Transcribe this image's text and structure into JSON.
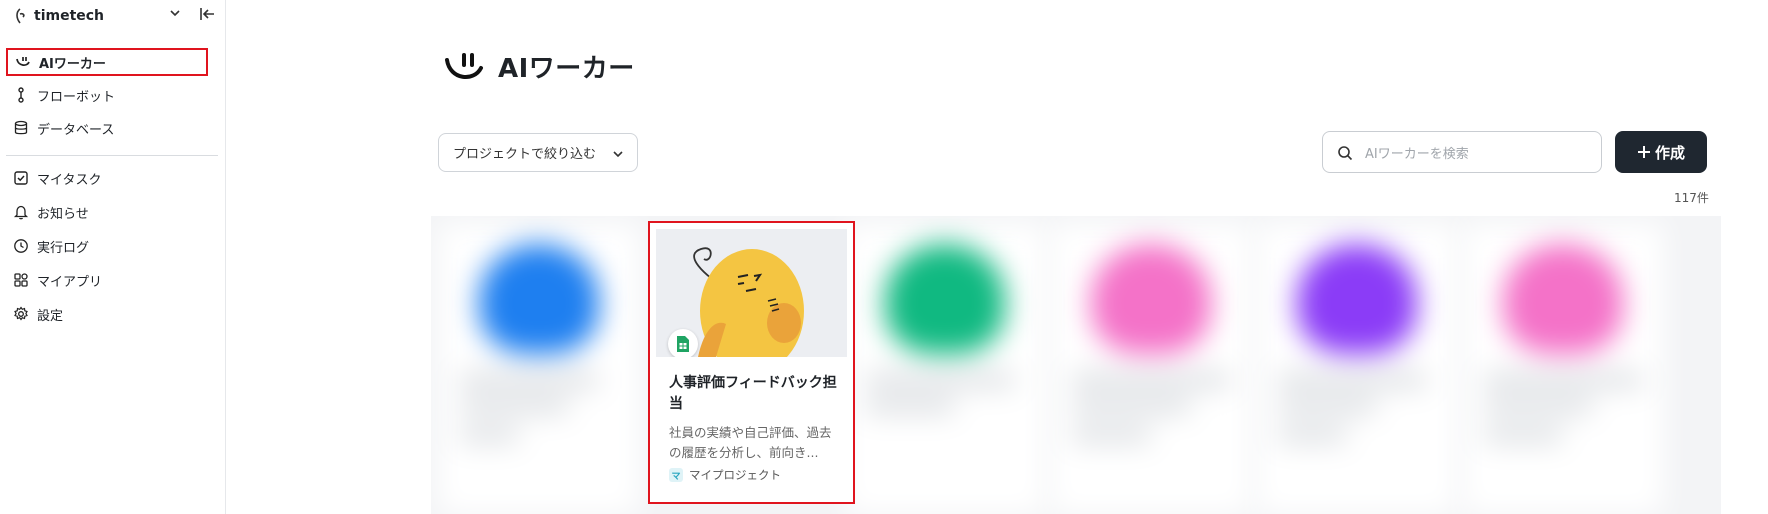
{
  "sidebar": {
    "workspace": "timetech",
    "items": [
      {
        "label": "AIワーカー"
      },
      {
        "label": "フローボット"
      },
      {
        "label": "データベース"
      },
      {
        "label": "マイタスク"
      },
      {
        "label": "お知らせ"
      },
      {
        "label": "実行ログ"
      },
      {
        "label": "マイアプリ"
      },
      {
        "label": "設定"
      }
    ]
  },
  "main": {
    "title": "AIワーカー",
    "filter_label": "プロジェクトで絞り込む",
    "search_placeholder": "AIワーカーを検索",
    "create_label": "作成",
    "count": "117件",
    "featured_card": {
      "title": "人事評価フィードバック担当",
      "description": "社員の実績や自己評価、過去の履歴を分析し、前向き...",
      "project": "マイプロジェクト",
      "project_icon_letter": "マ"
    }
  },
  "colors": {
    "highlight": "#e0141e",
    "create_button": "#1f2730",
    "blob_colors": [
      "#1e7ff0",
      "#10b981",
      "#f472c8",
      "#8b3cf7",
      "#f472c8"
    ]
  }
}
